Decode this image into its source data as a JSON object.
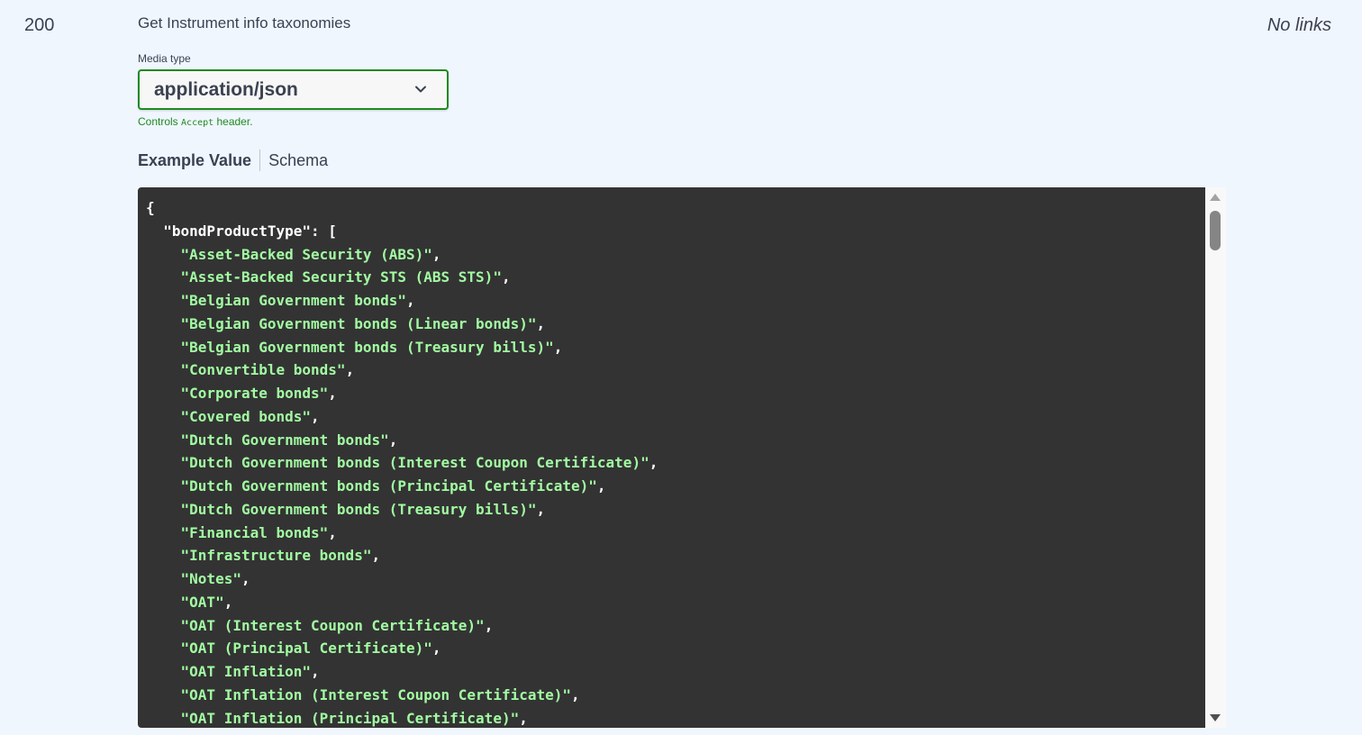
{
  "response": {
    "code": "200",
    "description": "Get Instrument info taxonomies",
    "links": "No links"
  },
  "media_type": {
    "label": "Media type",
    "selected": "application/json",
    "note_prefix": "Controls ",
    "note_code": "Accept",
    "note_suffix": " header."
  },
  "tabs": [
    {
      "label": "Example Value",
      "active": true
    },
    {
      "label": "Schema",
      "active": false
    }
  ],
  "example": {
    "open_brace": "{",
    "key": "\"bondProductType\"",
    "key_suffix": ": [",
    "items": [
      "\"Asset-Backed Security (ABS)\"",
      "\"Asset-Backed Security STS (ABS STS)\"",
      "\"Belgian Government bonds\"",
      "\"Belgian Government bonds (Linear bonds)\"",
      "\"Belgian Government bonds (Treasury bills)\"",
      "\"Convertible bonds\"",
      "\"Corporate bonds\"",
      "\"Covered bonds\"",
      "\"Dutch Government bonds\"",
      "\"Dutch Government bonds (Interest Coupon Certificate)\"",
      "\"Dutch Government bonds (Principal Certificate)\"",
      "\"Dutch Government bonds (Treasury bills)\"",
      "\"Financial bonds\"",
      "\"Infrastructure bonds\"",
      "\"Notes\"",
      "\"OAT\"",
      "\"OAT (Interest Coupon Certificate)\"",
      "\"OAT (Principal Certificate)\"",
      "\"OAT Inflation\"",
      "\"OAT Inflation (Interest Coupon Certificate)\"",
      "\"OAT Inflation (Principal Certificate)\""
    ],
    "item_suffix": ","
  },
  "colors": {
    "background": "#eff6fe",
    "code_background": "#333333",
    "string": "#a2fca2",
    "accent_green": "#1f8a1f"
  },
  "icons": {
    "select": "chevron-down-icon",
    "scroll_up": "scroll-up-arrow-icon",
    "scroll_down": "scroll-down-arrow-icon"
  }
}
